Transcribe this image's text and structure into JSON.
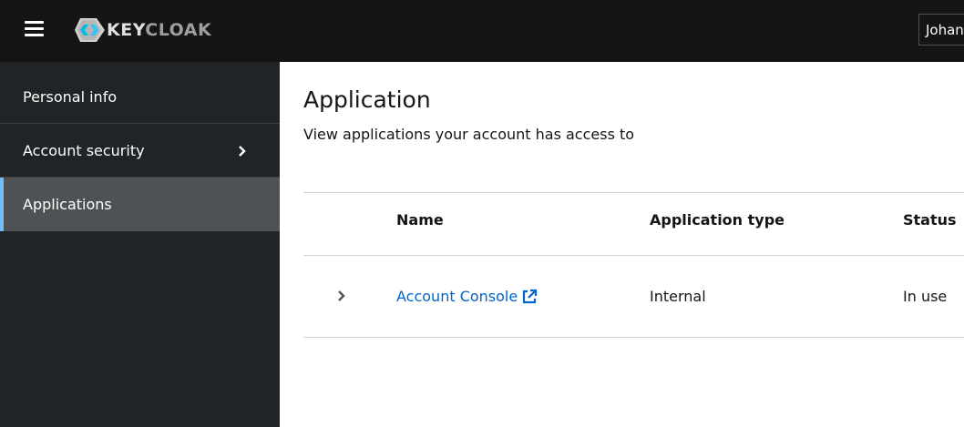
{
  "header": {
    "brand": {
      "part1": "KEY",
      "part2": "CLOAK"
    },
    "user_name": "Johan",
    "icons": {
      "menu": "hamburger-icon",
      "logo": "keycloak-logo-icon"
    }
  },
  "sidebar": {
    "items": [
      {
        "label": "Personal info",
        "active": false,
        "expandable": false
      },
      {
        "label": "Account security",
        "active": false,
        "expandable": true
      },
      {
        "label": "Applications",
        "active": true,
        "expandable": false
      }
    ]
  },
  "main": {
    "title": "Application",
    "subtitle": "View applications your account has access to",
    "table": {
      "columns": [
        "Name",
        "Application type",
        "Status"
      ],
      "rows": [
        {
          "name": "Account Console",
          "type": "Internal",
          "status": "In use"
        }
      ]
    }
  },
  "colors": {
    "masthead": "#151515",
    "sidebar": "#212427",
    "active_nav": "#4f5255",
    "active_accent": "#73bcf7",
    "link": "#0066cc"
  }
}
